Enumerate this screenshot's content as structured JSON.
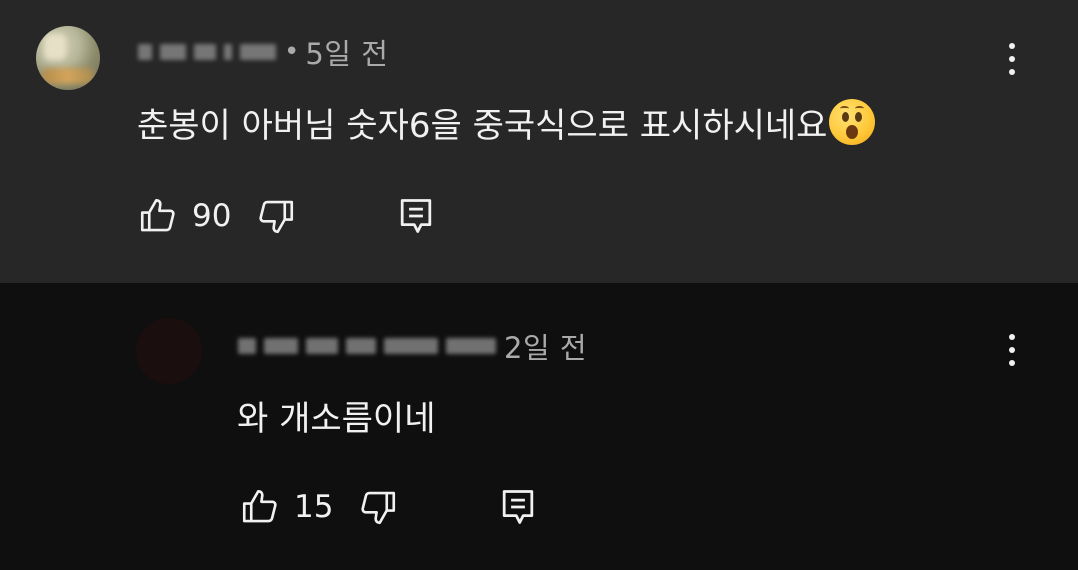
{
  "comments": [
    {
      "author": "(blurred)",
      "time": "5일 전",
      "text": "춘봉이 아버님 숫자6을 중국식으로 표시하시네요",
      "emoji": "astonished-face-emoji",
      "likes": "90"
    },
    {
      "author": "(blurred)",
      "time": "2일 전",
      "text": "와 개소름이네",
      "likes": "15"
    }
  ],
  "icons": {
    "like": "thumbs-up-icon",
    "dislike": "thumbs-down-icon",
    "reply": "reply-icon",
    "menu": "more-vertical-icon"
  },
  "colors": {
    "top_background": "#272727",
    "reply_background": "#0f0f0f",
    "primary_text": "#f1f1f1",
    "secondary_text": "#aaaaaa"
  }
}
